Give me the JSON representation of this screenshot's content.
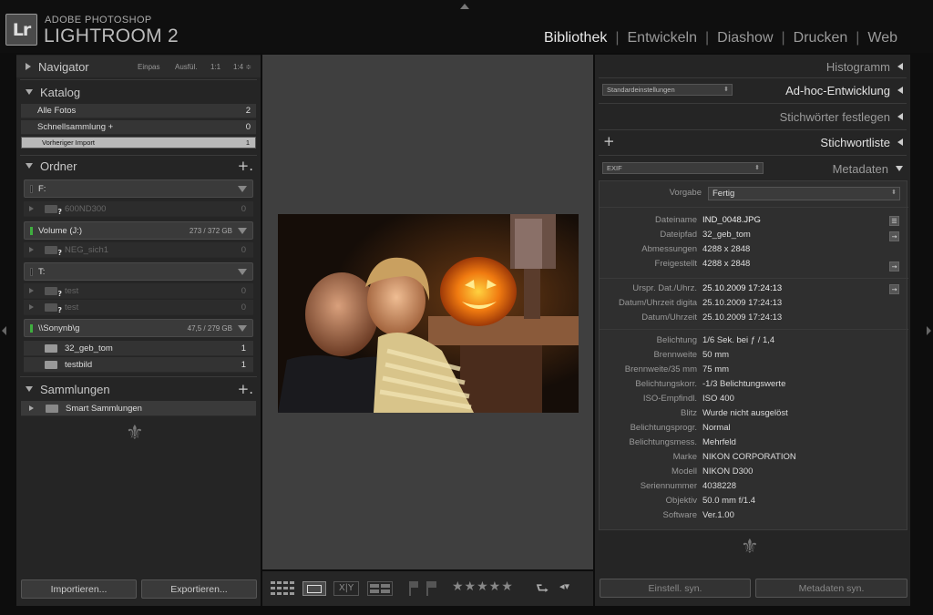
{
  "header": {
    "logo": "Lr",
    "brand_small": "ADOBE PHOTOSHOP",
    "brand_big": "LIGHTROOM 2",
    "modules": [
      "Bibliothek",
      "Entwickeln",
      "Diashow",
      "Drucken",
      "Web"
    ],
    "active_module": "Bibliothek"
  },
  "left": {
    "navigator": {
      "title": "Navigator",
      "options": [
        "Einpas",
        "Ausfül.",
        "1:1",
        "1:4 ≑"
      ]
    },
    "catalog": {
      "title": "Katalog",
      "items": [
        {
          "label": "Alle Fotos",
          "count": "2"
        },
        {
          "label": "Schnellsammlung  +",
          "count": "0"
        },
        {
          "label": "Vorheriger Import",
          "count": "1",
          "selected": true
        }
      ]
    },
    "folders": {
      "title": "Ordner",
      "plus": "+.",
      "vol_f": {
        "name": "F:",
        "size": ""
      },
      "f_600": {
        "name": "600ND300",
        "count": "0"
      },
      "vol_j": {
        "name": "Volume (J:)",
        "size": "273 / 372 GB"
      },
      "f_neg": {
        "name": "NEG_sich1",
        "count": "0"
      },
      "vol_t": {
        "name": "T:",
        "size": ""
      },
      "f_test1": {
        "name": "test",
        "count": "0"
      },
      "f_test2": {
        "name": "test",
        "count": "0"
      },
      "vol_s": {
        "name": "\\\\Sonynb\\g",
        "size": "47,5 / 279 GB"
      },
      "f_geb": {
        "name": "32_geb_tom",
        "count": "1"
      },
      "f_bild": {
        "name": "testbild",
        "count": "1"
      }
    },
    "collections": {
      "title": "Sammlungen",
      "plus": "+.",
      "item": "Smart Sammlungen"
    },
    "fleur": "⚜",
    "import_btn": "Importieren...",
    "export_btn": "Exportieren..."
  },
  "toolbar": {
    "stars": "★★★★★",
    "fleur": "⚜"
  },
  "right": {
    "histogram": "Histogramm",
    "adhoc": {
      "title": "Ad-hoc-Entwicklung",
      "preset": "Standardeinstellungen"
    },
    "keywording": "Stichwörter festlegen",
    "keywordlist": {
      "title": "Stichwortliste",
      "plus": "+"
    },
    "metadata": {
      "title": "Metadaten",
      "mode": "EXIF",
      "preset_label": "Vorgabe",
      "preset": "Fertig"
    },
    "rows": [
      {
        "k": "Dateiname",
        "v": "IND_0048.JPG"
      },
      {
        "k": "Dateipfad",
        "v": "32_geb_tom"
      },
      {
        "k": "Abmessungen",
        "v": "4288 x 2848"
      },
      {
        "k": "Freigestellt",
        "v": "4288 x 2848"
      },
      {
        "k": "Urspr. Dat./Uhrz.",
        "v": "25.10.2009 17:24:13"
      },
      {
        "k": "Datum/Uhrzeit digita",
        "v": "25.10.2009 17:24:13"
      },
      {
        "k": "Datum/Uhrzeit",
        "v": "25.10.2009 17:24:13"
      },
      {
        "k": "Belichtung",
        "v": "1/6 Sek. bei ƒ / 1,4"
      },
      {
        "k": "Brennweite",
        "v": "50 mm"
      },
      {
        "k": "Brennweite/35 mm",
        "v": "75 mm"
      },
      {
        "k": "Belichtungskorr.",
        "v": "-1/3 Belichtungswerte"
      },
      {
        "k": "ISO-Empfindl.",
        "v": "ISO 400"
      },
      {
        "k": "Blitz",
        "v": "Wurde nicht ausgelöst"
      },
      {
        "k": "Belichtungsprogr.",
        "v": "Normal"
      },
      {
        "k": "Belichtungsmess.",
        "v": "Mehrfeld"
      },
      {
        "k": "Marke",
        "v": "NIKON CORPORATION"
      },
      {
        "k": "Modell",
        "v": "NIKON D300"
      },
      {
        "k": "Seriennummer",
        "v": "4038228"
      },
      {
        "k": "Objektiv",
        "v": "50.0 mm f/1.4"
      },
      {
        "k": "Software",
        "v": "Ver.1.00"
      }
    ],
    "fleur": "⚜",
    "sync_settings": "Einstell. syn.",
    "sync_metadata": "Metadaten syn."
  }
}
